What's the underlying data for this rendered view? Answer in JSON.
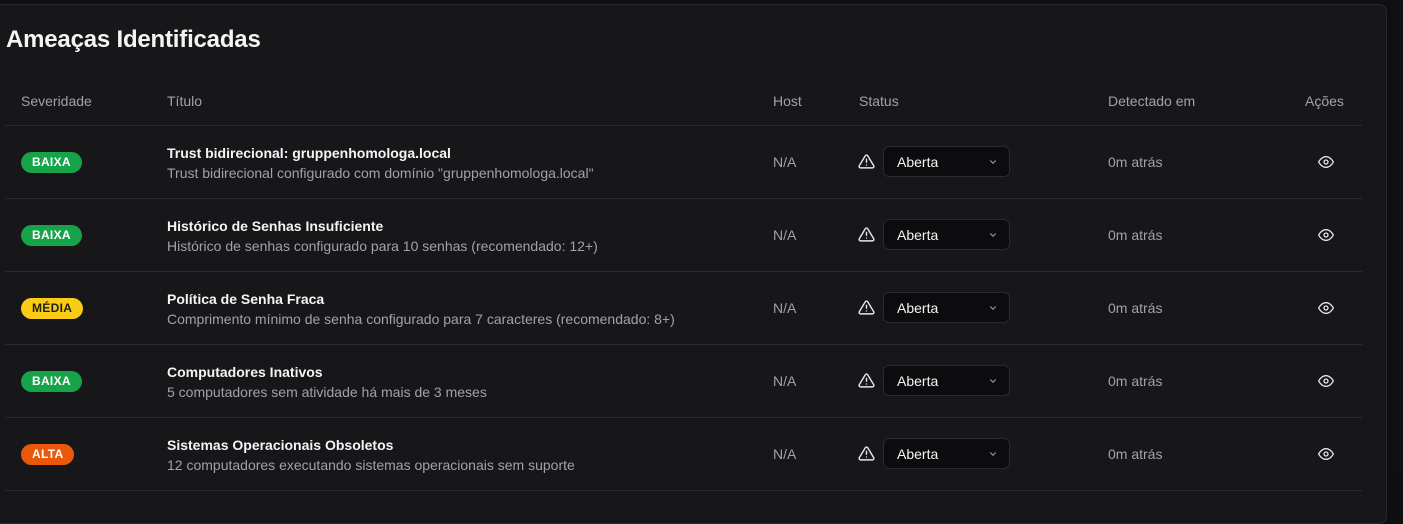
{
  "section": {
    "title": "Ameaças Identificadas"
  },
  "table": {
    "headers": {
      "severity": "Severidade",
      "title": "Título",
      "host": "Host",
      "status": "Status",
      "detected": "Detectado em",
      "actions": "Ações"
    },
    "rows": [
      {
        "severity": "BAIXA",
        "title": "Trust bidirecional: gruppenhomologa.local",
        "description": "Trust bidirecional configurado com domínio \"gruppenhomologa.local\"",
        "host": "N/A",
        "status": "Aberta",
        "detected": "0m atrás"
      },
      {
        "severity": "BAIXA",
        "title": "Histórico de Senhas Insuficiente",
        "description": "Histórico de senhas configurado para 10 senhas (recomendado: 12+)",
        "host": "N/A",
        "status": "Aberta",
        "detected": "0m atrás"
      },
      {
        "severity": "MÉDIA",
        "title": "Política de Senha Fraca",
        "description": "Comprimento mínimo de senha configurado para 7 caracteres (recomendado: 8+)",
        "host": "N/A",
        "status": "Aberta",
        "detected": "0m atrás"
      },
      {
        "severity": "BAIXA",
        "title": "Computadores Inativos",
        "description": "5 computadores sem atividade há mais de 3 meses",
        "host": "N/A",
        "status": "Aberta",
        "detected": "0m atrás"
      },
      {
        "severity": "ALTA",
        "title": "Sistemas Operacionais Obsoletos",
        "description": "12 computadores executando sistemas operacionais sem suporte",
        "host": "N/A",
        "status": "Aberta",
        "detected": "0m atrás"
      }
    ]
  },
  "colors": {
    "baixa": "#16a34a",
    "media": "#facc15",
    "alta": "#ea580c"
  },
  "icons": {
    "status": "warning-triangle-icon",
    "dropdown": "chevron-down-icon",
    "action": "eye-icon"
  }
}
